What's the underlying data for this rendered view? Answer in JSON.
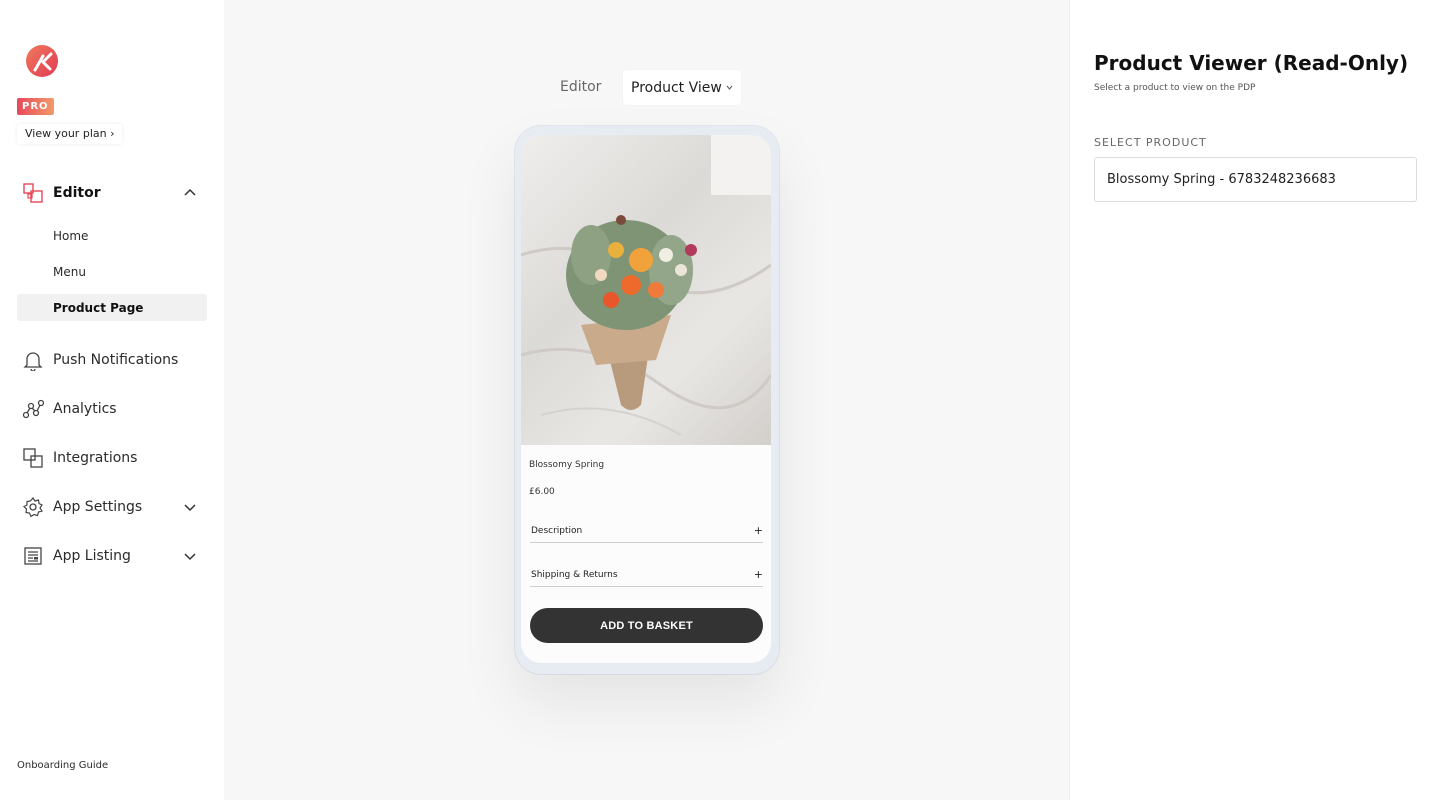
{
  "sidebar": {
    "pro_badge": "PRO",
    "plan_link": "View your plan ›",
    "editor": {
      "label": "Editor",
      "sub_items": [
        "Home",
        "Menu",
        "Product Page"
      ]
    },
    "items": [
      {
        "label": "Push Notifications",
        "icon": "bell-icon"
      },
      {
        "label": "Analytics",
        "icon": "analytics-icon"
      },
      {
        "label": "Integrations",
        "icon": "integrations-icon"
      },
      {
        "label": "App Settings",
        "icon": "settings-gear-icon"
      },
      {
        "label": "App Listing",
        "icon": "listing-icon"
      }
    ],
    "onboarding": "Onboarding Guide"
  },
  "center": {
    "editor_label": "Editor",
    "view_selected": "Product View",
    "phone": {
      "product_name": "Blossomy Spring",
      "price": "£6.00",
      "accordions": [
        "Description",
        "Shipping & Returns"
      ],
      "plus": "+",
      "button": "ADD TO BASKET"
    }
  },
  "right_panel": {
    "title": "Product Viewer (Read-Only)",
    "subtitle": "Select a product to view on the PDP",
    "field_label": "SELECT PRODUCT",
    "field_value": "Blossomy Spring - 6783248236683"
  },
  "colors": {
    "brand_red": "#e8485a",
    "button_dark": "#333333"
  }
}
